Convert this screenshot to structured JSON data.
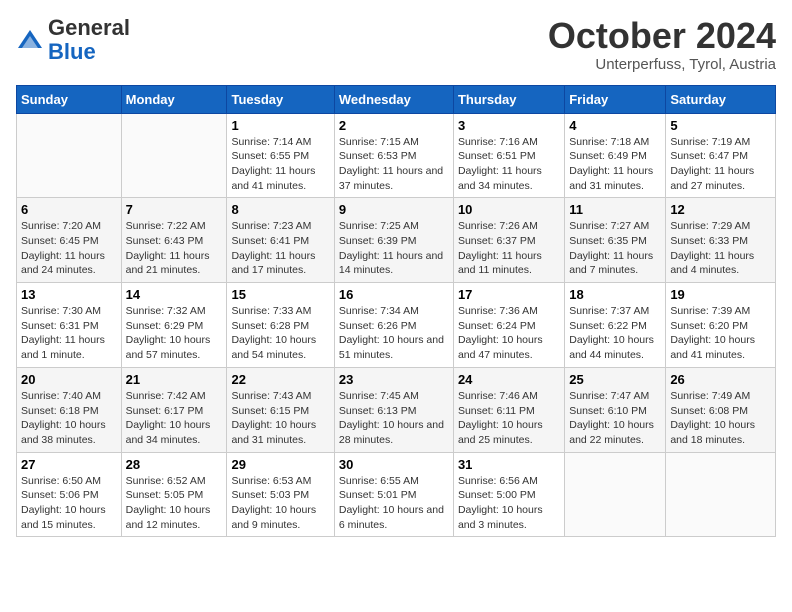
{
  "header": {
    "logo_general": "General",
    "logo_blue": "Blue",
    "month_title": "October 2024",
    "subtitle": "Unterperfuss, Tyrol, Austria"
  },
  "days_of_week": [
    "Sunday",
    "Monday",
    "Tuesday",
    "Wednesday",
    "Thursday",
    "Friday",
    "Saturday"
  ],
  "weeks": [
    [
      {
        "num": "",
        "info": ""
      },
      {
        "num": "",
        "info": ""
      },
      {
        "num": "1",
        "info": "Sunrise: 7:14 AM\nSunset: 6:55 PM\nDaylight: 11 hours and 41 minutes."
      },
      {
        "num": "2",
        "info": "Sunrise: 7:15 AM\nSunset: 6:53 PM\nDaylight: 11 hours and 37 minutes."
      },
      {
        "num": "3",
        "info": "Sunrise: 7:16 AM\nSunset: 6:51 PM\nDaylight: 11 hours and 34 minutes."
      },
      {
        "num": "4",
        "info": "Sunrise: 7:18 AM\nSunset: 6:49 PM\nDaylight: 11 hours and 31 minutes."
      },
      {
        "num": "5",
        "info": "Sunrise: 7:19 AM\nSunset: 6:47 PM\nDaylight: 11 hours and 27 minutes."
      }
    ],
    [
      {
        "num": "6",
        "info": "Sunrise: 7:20 AM\nSunset: 6:45 PM\nDaylight: 11 hours and 24 minutes."
      },
      {
        "num": "7",
        "info": "Sunrise: 7:22 AM\nSunset: 6:43 PM\nDaylight: 11 hours and 21 minutes."
      },
      {
        "num": "8",
        "info": "Sunrise: 7:23 AM\nSunset: 6:41 PM\nDaylight: 11 hours and 17 minutes."
      },
      {
        "num": "9",
        "info": "Sunrise: 7:25 AM\nSunset: 6:39 PM\nDaylight: 11 hours and 14 minutes."
      },
      {
        "num": "10",
        "info": "Sunrise: 7:26 AM\nSunset: 6:37 PM\nDaylight: 11 hours and 11 minutes."
      },
      {
        "num": "11",
        "info": "Sunrise: 7:27 AM\nSunset: 6:35 PM\nDaylight: 11 hours and 7 minutes."
      },
      {
        "num": "12",
        "info": "Sunrise: 7:29 AM\nSunset: 6:33 PM\nDaylight: 11 hours and 4 minutes."
      }
    ],
    [
      {
        "num": "13",
        "info": "Sunrise: 7:30 AM\nSunset: 6:31 PM\nDaylight: 11 hours and 1 minute."
      },
      {
        "num": "14",
        "info": "Sunrise: 7:32 AM\nSunset: 6:29 PM\nDaylight: 10 hours and 57 minutes."
      },
      {
        "num": "15",
        "info": "Sunrise: 7:33 AM\nSunset: 6:28 PM\nDaylight: 10 hours and 54 minutes."
      },
      {
        "num": "16",
        "info": "Sunrise: 7:34 AM\nSunset: 6:26 PM\nDaylight: 10 hours and 51 minutes."
      },
      {
        "num": "17",
        "info": "Sunrise: 7:36 AM\nSunset: 6:24 PM\nDaylight: 10 hours and 47 minutes."
      },
      {
        "num": "18",
        "info": "Sunrise: 7:37 AM\nSunset: 6:22 PM\nDaylight: 10 hours and 44 minutes."
      },
      {
        "num": "19",
        "info": "Sunrise: 7:39 AM\nSunset: 6:20 PM\nDaylight: 10 hours and 41 minutes."
      }
    ],
    [
      {
        "num": "20",
        "info": "Sunrise: 7:40 AM\nSunset: 6:18 PM\nDaylight: 10 hours and 38 minutes."
      },
      {
        "num": "21",
        "info": "Sunrise: 7:42 AM\nSunset: 6:17 PM\nDaylight: 10 hours and 34 minutes."
      },
      {
        "num": "22",
        "info": "Sunrise: 7:43 AM\nSunset: 6:15 PM\nDaylight: 10 hours and 31 minutes."
      },
      {
        "num": "23",
        "info": "Sunrise: 7:45 AM\nSunset: 6:13 PM\nDaylight: 10 hours and 28 minutes."
      },
      {
        "num": "24",
        "info": "Sunrise: 7:46 AM\nSunset: 6:11 PM\nDaylight: 10 hours and 25 minutes."
      },
      {
        "num": "25",
        "info": "Sunrise: 7:47 AM\nSunset: 6:10 PM\nDaylight: 10 hours and 22 minutes."
      },
      {
        "num": "26",
        "info": "Sunrise: 7:49 AM\nSunset: 6:08 PM\nDaylight: 10 hours and 18 minutes."
      }
    ],
    [
      {
        "num": "27",
        "info": "Sunrise: 6:50 AM\nSunset: 5:06 PM\nDaylight: 10 hours and 15 minutes."
      },
      {
        "num": "28",
        "info": "Sunrise: 6:52 AM\nSunset: 5:05 PM\nDaylight: 10 hours and 12 minutes."
      },
      {
        "num": "29",
        "info": "Sunrise: 6:53 AM\nSunset: 5:03 PM\nDaylight: 10 hours and 9 minutes."
      },
      {
        "num": "30",
        "info": "Sunrise: 6:55 AM\nSunset: 5:01 PM\nDaylight: 10 hours and 6 minutes."
      },
      {
        "num": "31",
        "info": "Sunrise: 6:56 AM\nSunset: 5:00 PM\nDaylight: 10 hours and 3 minutes."
      },
      {
        "num": "",
        "info": ""
      },
      {
        "num": "",
        "info": ""
      }
    ]
  ]
}
